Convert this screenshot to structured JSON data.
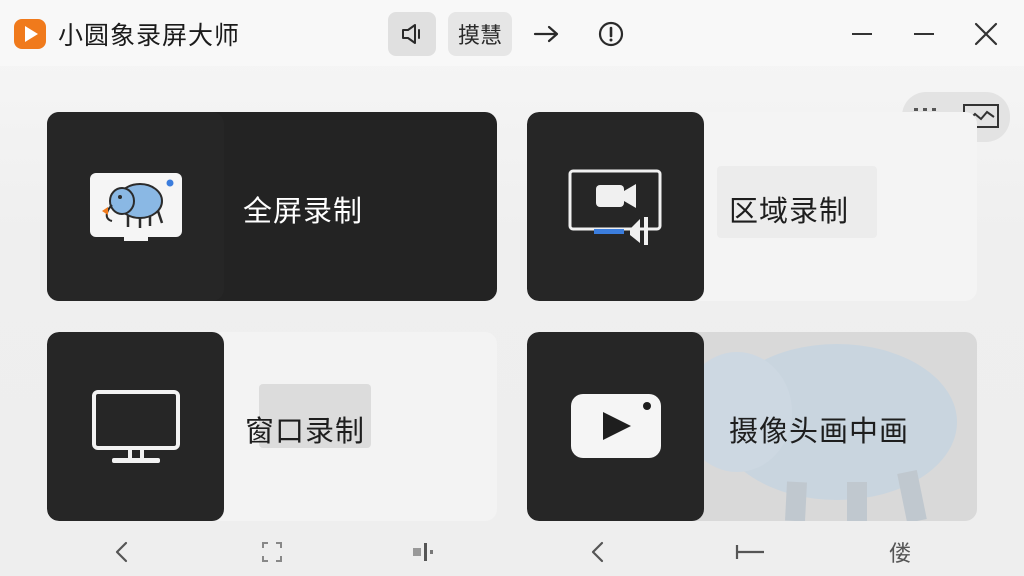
{
  "app": {
    "title": "小圆象录屏大师",
    "accent": "#f07a1c"
  },
  "toolbar": {
    "sound_icon": "speaker-icon",
    "text_button": "摸慧",
    "arrow_icon": "arrow-right-icon",
    "info_icon": "info-icon"
  },
  "window_controls": [
    "minimize-icon",
    "minimize-icon",
    "close-icon"
  ],
  "view_toggle": {
    "options": [
      "grid-icon",
      "chart-icon"
    ]
  },
  "cards": {
    "full": {
      "label": "全屏录制",
      "icon": "elephant-screen-icon"
    },
    "region": {
      "label": "区域录制",
      "icon": "region-camera-icon"
    },
    "window": {
      "label": "窗口录制",
      "icon": "monitor-icon"
    },
    "camera": {
      "label": "摄像头画中画",
      "icon": "video-play-icon"
    }
  },
  "bottom_nav": {
    "items": [
      "back-icon",
      "crop-icon",
      "split-icon",
      "back-icon",
      "dash-icon"
    ],
    "last_label": "偻"
  },
  "colors": {
    "card_dark": "#262626",
    "card_light": "#f4f4f4",
    "elephant_blue": "#8ab8e4"
  }
}
